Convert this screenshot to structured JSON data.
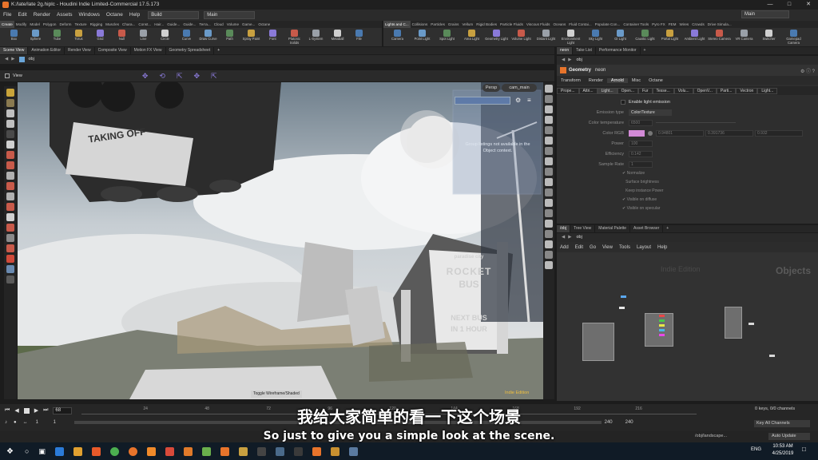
{
  "window": {
    "title": "K:/late/late 2g.hiplc - Houdini Indie Limited-Commercial 17.5.173",
    "desktop_label": "Main"
  },
  "menu": {
    "items": [
      "File",
      "Edit",
      "Render",
      "Assets",
      "Windows",
      "Octane",
      "Help"
    ],
    "build": "Build",
    "desktop": "Main"
  },
  "shelf_left": {
    "tabs": [
      "Create",
      "Modify",
      "Model",
      "Polygon",
      "Deform",
      "Texture",
      "Rigging",
      "Muscles",
      "Chara...",
      "Const...",
      "Hair...",
      "Guide...",
      "Guide...",
      "Terra...",
      "Cloud",
      "Volume",
      "Game...",
      "Octane"
    ],
    "tools": [
      "Box",
      "Sphere",
      "Tube",
      "Torus",
      "Grid",
      "Null",
      "Line",
      "Circle",
      "Curve",
      "Draw Curve",
      "Path",
      "Spray Paint",
      "Font",
      "Platonic Solids",
      "L-System",
      "Metaball",
      "File"
    ]
  },
  "shelf_right": {
    "tabs": [
      "Lights and C...",
      "Collisions",
      "Particles",
      "Grains",
      "Vellum",
      "Rigid Bodies",
      "Particle Fluids",
      "Viscous Fluids",
      "Oceans",
      "Fluid Contai...",
      "Populate Con...",
      "Container Tools",
      "Pyro FX",
      "FEM",
      "Wires",
      "Crowds",
      "Drive Simula..."
    ],
    "tools": [
      "Camera",
      "Point Light",
      "Spot Light",
      "Area Light",
      "Geometry Light",
      "Volume Light",
      "Distant Light",
      "Environment Light",
      "Sky Light",
      "GI Light",
      "Caustic Light",
      "Portal Light",
      "Ambient Light",
      "Stereo Camera",
      "VR Camera",
      "Switcher",
      "Gamepad Camera"
    ]
  },
  "scene_tabs": [
    "Scene View",
    "Animation Editor",
    "Render View",
    "Composite View",
    "Motion FX View",
    "Geometry Spreadsheet"
  ],
  "scene_path": "obj",
  "view_label": "View",
  "viewport": {
    "persp": "Persp",
    "cam": "cam_main",
    "billboard": [
      "TAKING OFF"
    ],
    "sign": [
      "paradise city",
      "ROCKET",
      "BUS",
      "NEXT BUS",
      "IN 1 HOUR"
    ],
    "overlay_msg": "Group listings not available in the Object context.",
    "toggle_label": "Toggle Wireframe/Shaded",
    "edition": "Indie Edition"
  },
  "params": {
    "tabs_top": [
      "neon",
      "Take List",
      "Performance Monitor"
    ],
    "path": "obj",
    "node_type": "Geometry",
    "node_name": "neon",
    "tabs": [
      "Transform",
      "Render",
      "Arnold",
      "Misc",
      "Octane"
    ],
    "subtabs": [
      "Prope...",
      "Attri...",
      "Light...",
      "Open...",
      "Fur",
      "Tesse...",
      "Volu...",
      "OpenV...",
      "Parti...",
      "Vectron",
      "Light..."
    ],
    "enable_light": "Enable light emission",
    "rows": [
      {
        "label": "Emission type",
        "value": "Color/Texture"
      },
      {
        "label": "Color temperature",
        "value": "6500"
      },
      {
        "label": "Color RGB",
        "value": "",
        "v2": "0.94801",
        "v3": "0.391736",
        "v4": "0.932"
      },
      {
        "label": "Power",
        "value": "100"
      },
      {
        "label": "Efficiency",
        "value": "0.142"
      },
      {
        "label": "Sample Rate",
        "value": "1"
      }
    ],
    "checks": [
      "Normalize",
      "Surface brightness",
      "Keep instance Power",
      "Visible on diffuse",
      "Visible on specular"
    ],
    "light_color": "#d28ad6"
  },
  "network": {
    "tabs": [
      "/obj",
      "Tree View",
      "Material Palette",
      "Asset Browser"
    ],
    "path": "obj",
    "menu": [
      "Add",
      "Edit",
      "Go",
      "View",
      "Tools",
      "Layout",
      "Help"
    ],
    "watermark": "Indie Edition",
    "context": "Objects"
  },
  "timeline": {
    "frame": "68",
    "start": "1",
    "step": "1",
    "end1": "240",
    "end2": "240",
    "ticks": [
      "24",
      "48",
      "72",
      "96",
      "120",
      "144",
      "168",
      "192",
      "216"
    ],
    "keys": "0 keys, 0/0 channels",
    "key_all": "Key All Channels",
    "path": "/obj/landscape...",
    "auto_update": "Auto Update"
  },
  "subtitles": {
    "cn": "我给大家简单的看一下这个场景",
    "en": "So just to give you a simple look at the scene."
  },
  "taskbar": {
    "lang": "ENG",
    "time": "10:53 AM",
    "date": "4/25/2019"
  }
}
